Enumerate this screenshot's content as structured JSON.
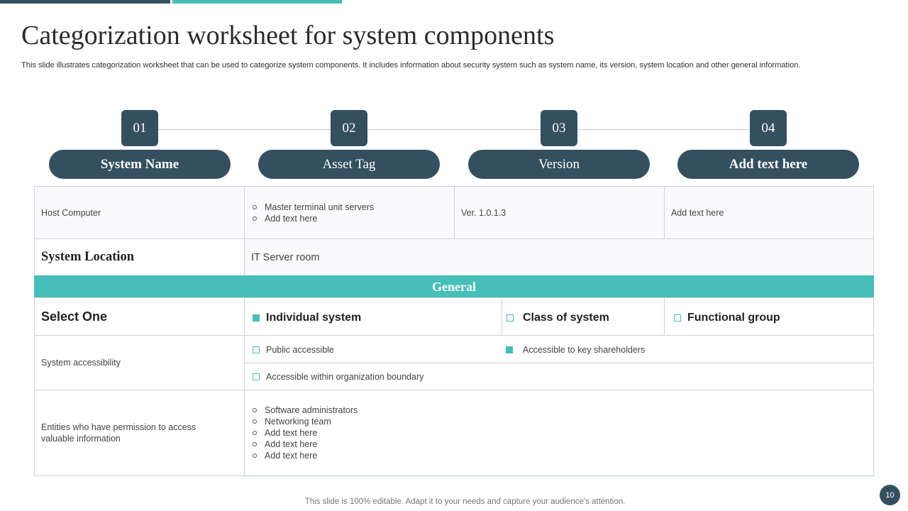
{
  "title": "Categorization worksheet for system components",
  "subtitle": "This slide illustrates categorization worksheet that can be used to categorize system components. It includes information about security system such as system name, its version, system location and other general information.",
  "steps": [
    {
      "number": "01",
      "label": "System Name"
    },
    {
      "number": "02",
      "label": "Asset Tag"
    },
    {
      "number": "03",
      "label": "Version"
    },
    {
      "number": "04",
      "label": "Add text here"
    }
  ],
  "row1": {
    "system_name": "Host Computer",
    "asset_tag_items": [
      "Master terminal unit servers",
      "Add text here"
    ],
    "version": "Ver. 1.0.1.3",
    "other": "Add text here"
  },
  "location": {
    "label": "System Location",
    "value": "IT Server room"
  },
  "general_header": "General",
  "select_one": {
    "label": "Select One",
    "options": [
      {
        "label": "Individual system",
        "checked": true
      },
      {
        "label": "Class of system",
        "checked": false
      },
      {
        "label": "Functional group",
        "checked": false
      }
    ]
  },
  "accessibility": {
    "label": "System accessibility",
    "options": [
      {
        "label": "Public accessible",
        "checked": false
      },
      {
        "label": "Accessible to key shareholders",
        "checked": true
      },
      {
        "label": "Accessible within organization boundary",
        "checked": false
      }
    ]
  },
  "entities": {
    "label": "Entities who have permission to access valuable information",
    "items": [
      "Software administrators",
      "Networking team",
      "Add text here",
      "Add text here",
      "Add text here"
    ]
  },
  "footer": "This slide is 100% editable. Adapt it to your needs and capture your audience's attention.",
  "page_number": "10",
  "colors": {
    "dark": "#34505f",
    "teal": "#45bfb8"
  }
}
